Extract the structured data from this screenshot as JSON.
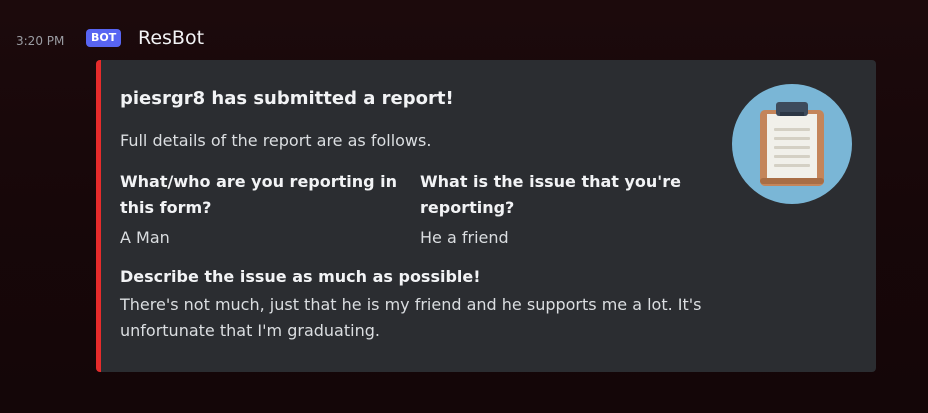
{
  "message": {
    "timestamp": "3:20 PM",
    "badge": "BOT",
    "username": "ResBot"
  },
  "embed": {
    "accent_color": "#e62b2b",
    "title": "piesrgr8 has submitted a report!",
    "description": "Full details of the report are as follows.",
    "fields": [
      {
        "name": "What/who are you reporting in this form?",
        "value": "A Man"
      },
      {
        "name": "What is the issue that you're reporting?",
        "value": "He a friend"
      },
      {
        "name": "Describe the issue as much as possible!",
        "value": "There's not much, just that he is my friend and he supports me a lot. It's unfortunate that I'm graduating."
      }
    ],
    "thumbnail_icon": "clipboard-icon"
  }
}
